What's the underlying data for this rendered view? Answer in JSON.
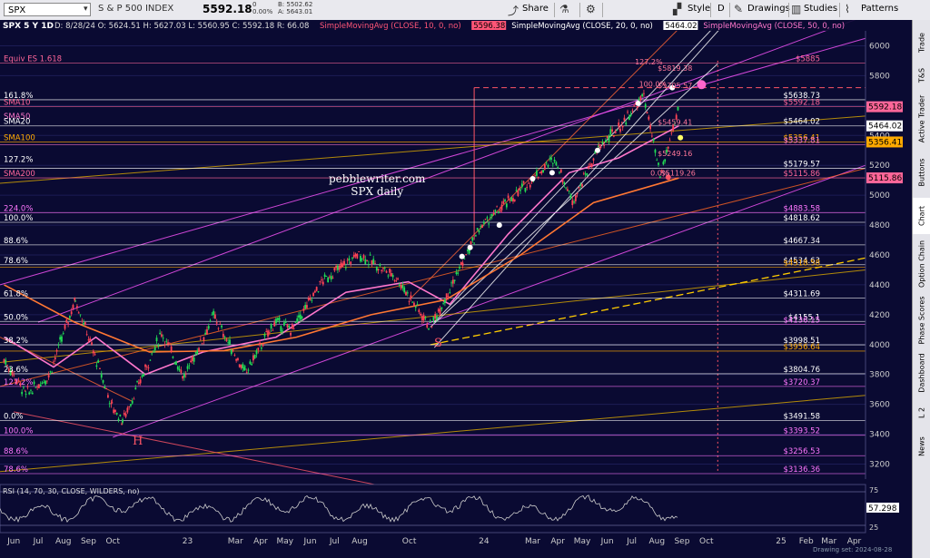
{
  "toolbar": {
    "symbol": "SPX",
    "symbol_caret": "▾",
    "name": "S & P 500 INDEX",
    "price": "5592.18",
    "change_up": "0",
    "change_pct": "0.00%",
    "bid": "B: 5502.62",
    "ask": "A: 5643.01",
    "share_label": "Share",
    "style_label": "Style",
    "period_label": "D",
    "drawings_label": "Drawings",
    "studies_label": "Studies",
    "patterns_label": "Patterns",
    "share_icon": "share-icon",
    "flask_icon": "flask-icon",
    "gear_icon": "gear-icon",
    "pencil_icon": "pencil-icon",
    "bars_icon": "bars-icon",
    "pattern_icon": "pattern-icon"
  },
  "sidebar": {
    "tabs": [
      "Trade",
      "T&S",
      "Active Trader",
      "Buttons",
      "Chart",
      "Option Chain",
      "Phase Scores",
      "Dashboard",
      "L 2",
      "News"
    ],
    "active": "Chart"
  },
  "annotations": {
    "site": "pebblewriter.com",
    "subtitle": "SPX daily",
    "head_marker": "H",
    "shoulder_marker": "S"
  },
  "rsi_header": "RSI (14, 70, 30, CLOSE, WILDERS, no)",
  "watermark": "Drawing set: 2024-08-28",
  "chart_data": {
    "type": "candlestick",
    "title": "SPX 5 Y 1D",
    "header_ohlc": "D: 8/28/24  O: 5624.51  H: 5627.03  L: 5560.95  C: 5592.18  R: 66.08",
    "studies": [
      {
        "label": "SimpleMovingAvg (CLOSE, 10, 0, no)",
        "value": "5596.38",
        "color": "#ff5577"
      },
      {
        "label": "SimpleMovingAvg (CLOSE, 20, 0, no)",
        "value": "5464.02",
        "color": "#ffffff"
      },
      {
        "label": "SimpleMovingAvg (CLOSE, 50, 0, no)",
        "value": "",
        "color": "#ff77cc"
      }
    ],
    "y_axis": {
      "min": 3100,
      "max": 6100,
      "ticks": [
        3200,
        3400,
        3600,
        3800,
        4000,
        4200,
        4400,
        4600,
        4800,
        5000,
        5200,
        5400,
        5600,
        5800,
        6000
      ]
    },
    "x_axis": {
      "start": "2022-05-15",
      "end": "2025-04-15",
      "ticks": [
        {
          "label": "Jun",
          "date": "2022-06-01"
        },
        {
          "label": "Jul",
          "date": "2022-07-01"
        },
        {
          "label": "Aug",
          "date": "2022-08-01"
        },
        {
          "label": "Sep",
          "date": "2022-09-01"
        },
        {
          "label": "Oct",
          "date": "2022-10-01"
        },
        {
          "label": "23",
          "date": "2023-01-01"
        },
        {
          "label": "Mar",
          "date": "2023-03-01"
        },
        {
          "label": "Apr",
          "date": "2023-04-01"
        },
        {
          "label": "May",
          "date": "2023-05-01"
        },
        {
          "label": "Jun",
          "date": "2023-06-01"
        },
        {
          "label": "Jul",
          "date": "2023-07-01"
        },
        {
          "label": "Aug",
          "date": "2023-08-01"
        },
        {
          "label": "Oct",
          "date": "2023-10-01"
        },
        {
          "label": "24",
          "date": "2024-01-01"
        },
        {
          "label": "Mar",
          "date": "2024-03-01"
        },
        {
          "label": "Apr",
          "date": "2024-04-01"
        },
        {
          "label": "May",
          "date": "2024-05-01"
        },
        {
          "label": "Jun",
          "date": "2024-06-01"
        },
        {
          "label": "Jul",
          "date": "2024-07-01"
        },
        {
          "label": "Aug",
          "date": "2024-08-01"
        },
        {
          "label": "Sep",
          "date": "2024-09-01"
        },
        {
          "label": "Oct",
          "date": "2024-10-01"
        },
        {
          "label": "25",
          "date": "2025-01-01"
        },
        {
          "label": "Feb",
          "date": "2025-02-01"
        },
        {
          "label": "Mar",
          "date": "2025-03-01"
        },
        {
          "label": "Apr",
          "date": "2025-04-01"
        }
      ]
    },
    "price_path": [
      [
        "2022-05-20",
        3900
      ],
      [
        "2022-06-16",
        3666
      ],
      [
        "2022-07-14",
        3790
      ],
      [
        "2022-08-16",
        4305
      ],
      [
        "2022-09-30",
        3585
      ],
      [
        "2022-10-13",
        3491
      ],
      [
        "2022-11-30",
        4080
      ],
      [
        "2022-12-28",
        3783
      ],
      [
        "2023-02-02",
        4195
      ],
      [
        "2023-03-13",
        3808
      ],
      [
        "2023-04-18",
        4150
      ],
      [
        "2023-05-10",
        4100
      ],
      [
        "2023-06-15",
        4420
      ],
      [
        "2023-07-31",
        4607
      ],
      [
        "2023-09-15",
        4450
      ],
      [
        "2023-10-27",
        4117
      ],
      [
        "2023-12-28",
        4790
      ],
      [
        "2024-02-15",
        5030
      ],
      [
        "2024-03-28",
        5250
      ],
      [
        "2024-04-19",
        4960
      ],
      [
        "2024-05-22",
        5320
      ],
      [
        "2024-06-20",
        5480
      ],
      [
        "2024-07-16",
        5669
      ],
      [
        "2024-08-05",
        5119
      ],
      [
        "2024-08-28",
        5592
      ]
    ],
    "moving_averages": [
      {
        "name": "SMA50",
        "color": "#ff77cc",
        "points": [
          [
            "2022-05-20",
            4050
          ],
          [
            "2022-07-20",
            3850
          ],
          [
            "2022-09-10",
            4050
          ],
          [
            "2022-11-10",
            3800
          ],
          [
            "2023-01-20",
            3950
          ],
          [
            "2023-04-20",
            4050
          ],
          [
            "2023-07-15",
            4350
          ],
          [
            "2023-09-30",
            4420
          ],
          [
            "2023-11-20",
            4270
          ],
          [
            "2024-01-31",
            4740
          ],
          [
            "2024-04-15",
            5150
          ],
          [
            "2024-06-15",
            5250
          ],
          [
            "2024-08-28",
            5464
          ]
        ]
      },
      {
        "name": "SMA200",
        "color": "#ff7733",
        "points": [
          [
            "2022-05-20",
            4400
          ],
          [
            "2022-08-15",
            4150
          ],
          [
            "2022-11-15",
            3950
          ],
          [
            "2023-02-15",
            3960
          ],
          [
            "2023-05-15",
            4050
          ],
          [
            "2023-08-15",
            4200
          ],
          [
            "2023-11-15",
            4300
          ],
          [
            "2024-02-15",
            4600
          ],
          [
            "2024-05-15",
            4950
          ],
          [
            "2024-08-28",
            5115
          ]
        ]
      }
    ],
    "levels": [
      {
        "value": 5885,
        "label": "$5885",
        "color": "#ff6699"
      },
      {
        "value": 5638.73,
        "label": "$5638.73",
        "color": "#ffffff"
      },
      {
        "value": 5592.18,
        "label": "$5592.18",
        "color": "#ff6699"
      },
      {
        "value": 5464.02,
        "label": "$5464.02",
        "color": "#ffffff"
      },
      {
        "value": 5356.41,
        "label": "$5356.41",
        "color": "#ffaa00"
      },
      {
        "value": 5337.81,
        "label": "$5337.81",
        "color": "#ff77cc"
      },
      {
        "value": 5179.57,
        "label": "$5179.57",
        "color": "#ffffff"
      },
      {
        "value": 5115.86,
        "label": "$5115.86",
        "color": "#ff6699"
      },
      {
        "value": 4883.58,
        "label": "$4883.58",
        "color": "#ff77ff"
      },
      {
        "value": 4818.62,
        "label": "$4818.62",
        "color": "#ffffff"
      },
      {
        "value": 4667.34,
        "label": "$4667.34",
        "color": "#ffffff"
      },
      {
        "value": 4534.63,
        "label": "$4534.63",
        "color": "#ffffff"
      },
      {
        "value": 4518.58,
        "label": "$4518.58",
        "color": "#ffaa00"
      },
      {
        "value": 4311.69,
        "label": "$4311.69",
        "color": "#ffffff"
      },
      {
        "value": 4155.1,
        "label": "$4155.1",
        "color": "#ffffff"
      },
      {
        "value": 4136.15,
        "label": "$4136.15",
        "color": "#ff77ff"
      },
      {
        "value": 3998.51,
        "label": "$3998.51",
        "color": "#ffffff"
      },
      {
        "value": 3956.64,
        "label": "$3956.64",
        "color": "#ffaa00"
      },
      {
        "value": 3804.76,
        "label": "$3804.76",
        "color": "#ffffff"
      },
      {
        "value": 3720.37,
        "label": "$3720.37",
        "color": "#ff77ff"
      },
      {
        "value": 3491.58,
        "label": "$3491.58",
        "color": "#ffffff"
      },
      {
        "value": 3393.52,
        "label": "$3393.52",
        "color": "#ff77ff"
      },
      {
        "value": 3256.53,
        "label": "$3256.53",
        "color": "#ff77ff"
      },
      {
        "value": 3136.36,
        "label": "$3136.36",
        "color": "#ff77ff"
      }
    ],
    "left_labels": [
      {
        "value": 5885,
        "label": "Equiv ES 1.618",
        "color": "#ff6699"
      },
      {
        "value": 5638.73,
        "label": "161.8%",
        "color": "#ffffff"
      },
      {
        "value": 5592.18,
        "label": "SMA10",
        "color": "#ff6699"
      },
      {
        "value": 5500,
        "label": "SMA50",
        "color": "#ff77cc"
      },
      {
        "value": 5464.02,
        "label": "SMA20",
        "color": "#ffffff"
      },
      {
        "value": 5356.41,
        "label": "SMA100",
        "color": "#ffaa00"
      },
      {
        "value": 5210,
        "label": "127.2%",
        "color": "#ffffff"
      },
      {
        "value": 5115.86,
        "label": "SMA200",
        "color": "#ff6699"
      },
      {
        "value": 4883.58,
        "label": "224.0%",
        "color": "#ff77ff"
      },
      {
        "value": 4818.62,
        "label": "100.0%",
        "color": "#ffffff"
      },
      {
        "value": 4667.34,
        "label": "88.6%",
        "color": "#ffffff"
      },
      {
        "value": 4534.63,
        "label": "78.6%",
        "color": "#ffffff"
      },
      {
        "value": 4311.69,
        "label": "61.8%",
        "color": "#ffffff"
      },
      {
        "value": 4155.1,
        "label": "50.0%",
        "color": "#ffffff"
      },
      {
        "value": 3998.51,
        "label": "38.2%",
        "color": "#ffffff"
      },
      {
        "value": 3804.76,
        "label": "23.6%",
        "color": "#ffffff"
      },
      {
        "value": 3720.37,
        "label": "127.2%",
        "color": "#ff77ff"
      },
      {
        "value": 3491.58,
        "label": "0.0%",
        "color": "#ffffff"
      },
      {
        "value": 3393.52,
        "label": "100.0%",
        "color": "#ff77ff"
      },
      {
        "value": 3256.53,
        "label": "88.6%",
        "color": "#ff77ff"
      },
      {
        "value": 3136.36,
        "label": "78.6%",
        "color": "#ff77ff"
      }
    ],
    "price_tags": [
      {
        "value": 5592.18,
        "label": "5592.18",
        "bg": "#ff6699",
        "fg": "#000"
      },
      {
        "value": 5464.02,
        "label": "5464.02",
        "bg": "#ffffff",
        "fg": "#000"
      },
      {
        "value": 5356.41,
        "label": "5356.41",
        "bg": "#ffaa00",
        "fg": "#000"
      },
      {
        "value": 5115.86,
        "label": "5115.86",
        "bg": "#ff6699",
        "fg": "#000"
      }
    ],
    "inner_fib_labels": [
      {
        "date": "2024-07-05",
        "value": 5862,
        "label": "127.2%"
      },
      {
        "date": "2024-08-02",
        "value": 5819.38,
        "label": "$5819.38"
      },
      {
        "date": "2024-07-10",
        "value": 5715,
        "label": "100.0%"
      },
      {
        "date": "2024-08-02",
        "value": 5705.57,
        "label": "$5705.57"
      },
      {
        "date": "2024-08-02",
        "value": 5459.41,
        "label": "$5459.41"
      },
      {
        "date": "2024-08-02",
        "value": 5249.16,
        "label": "$5249.16"
      },
      {
        "date": "2024-07-24",
        "value": 5120,
        "label": "0.0%"
      },
      {
        "date": "2024-08-06",
        "value": 5119.26,
        "label": "$5119.26"
      }
    ],
    "rsi": {
      "value": "57.298",
      "overbought": 70,
      "oversold": 30,
      "axis_ticks": [
        75,
        25
      ]
    }
  }
}
